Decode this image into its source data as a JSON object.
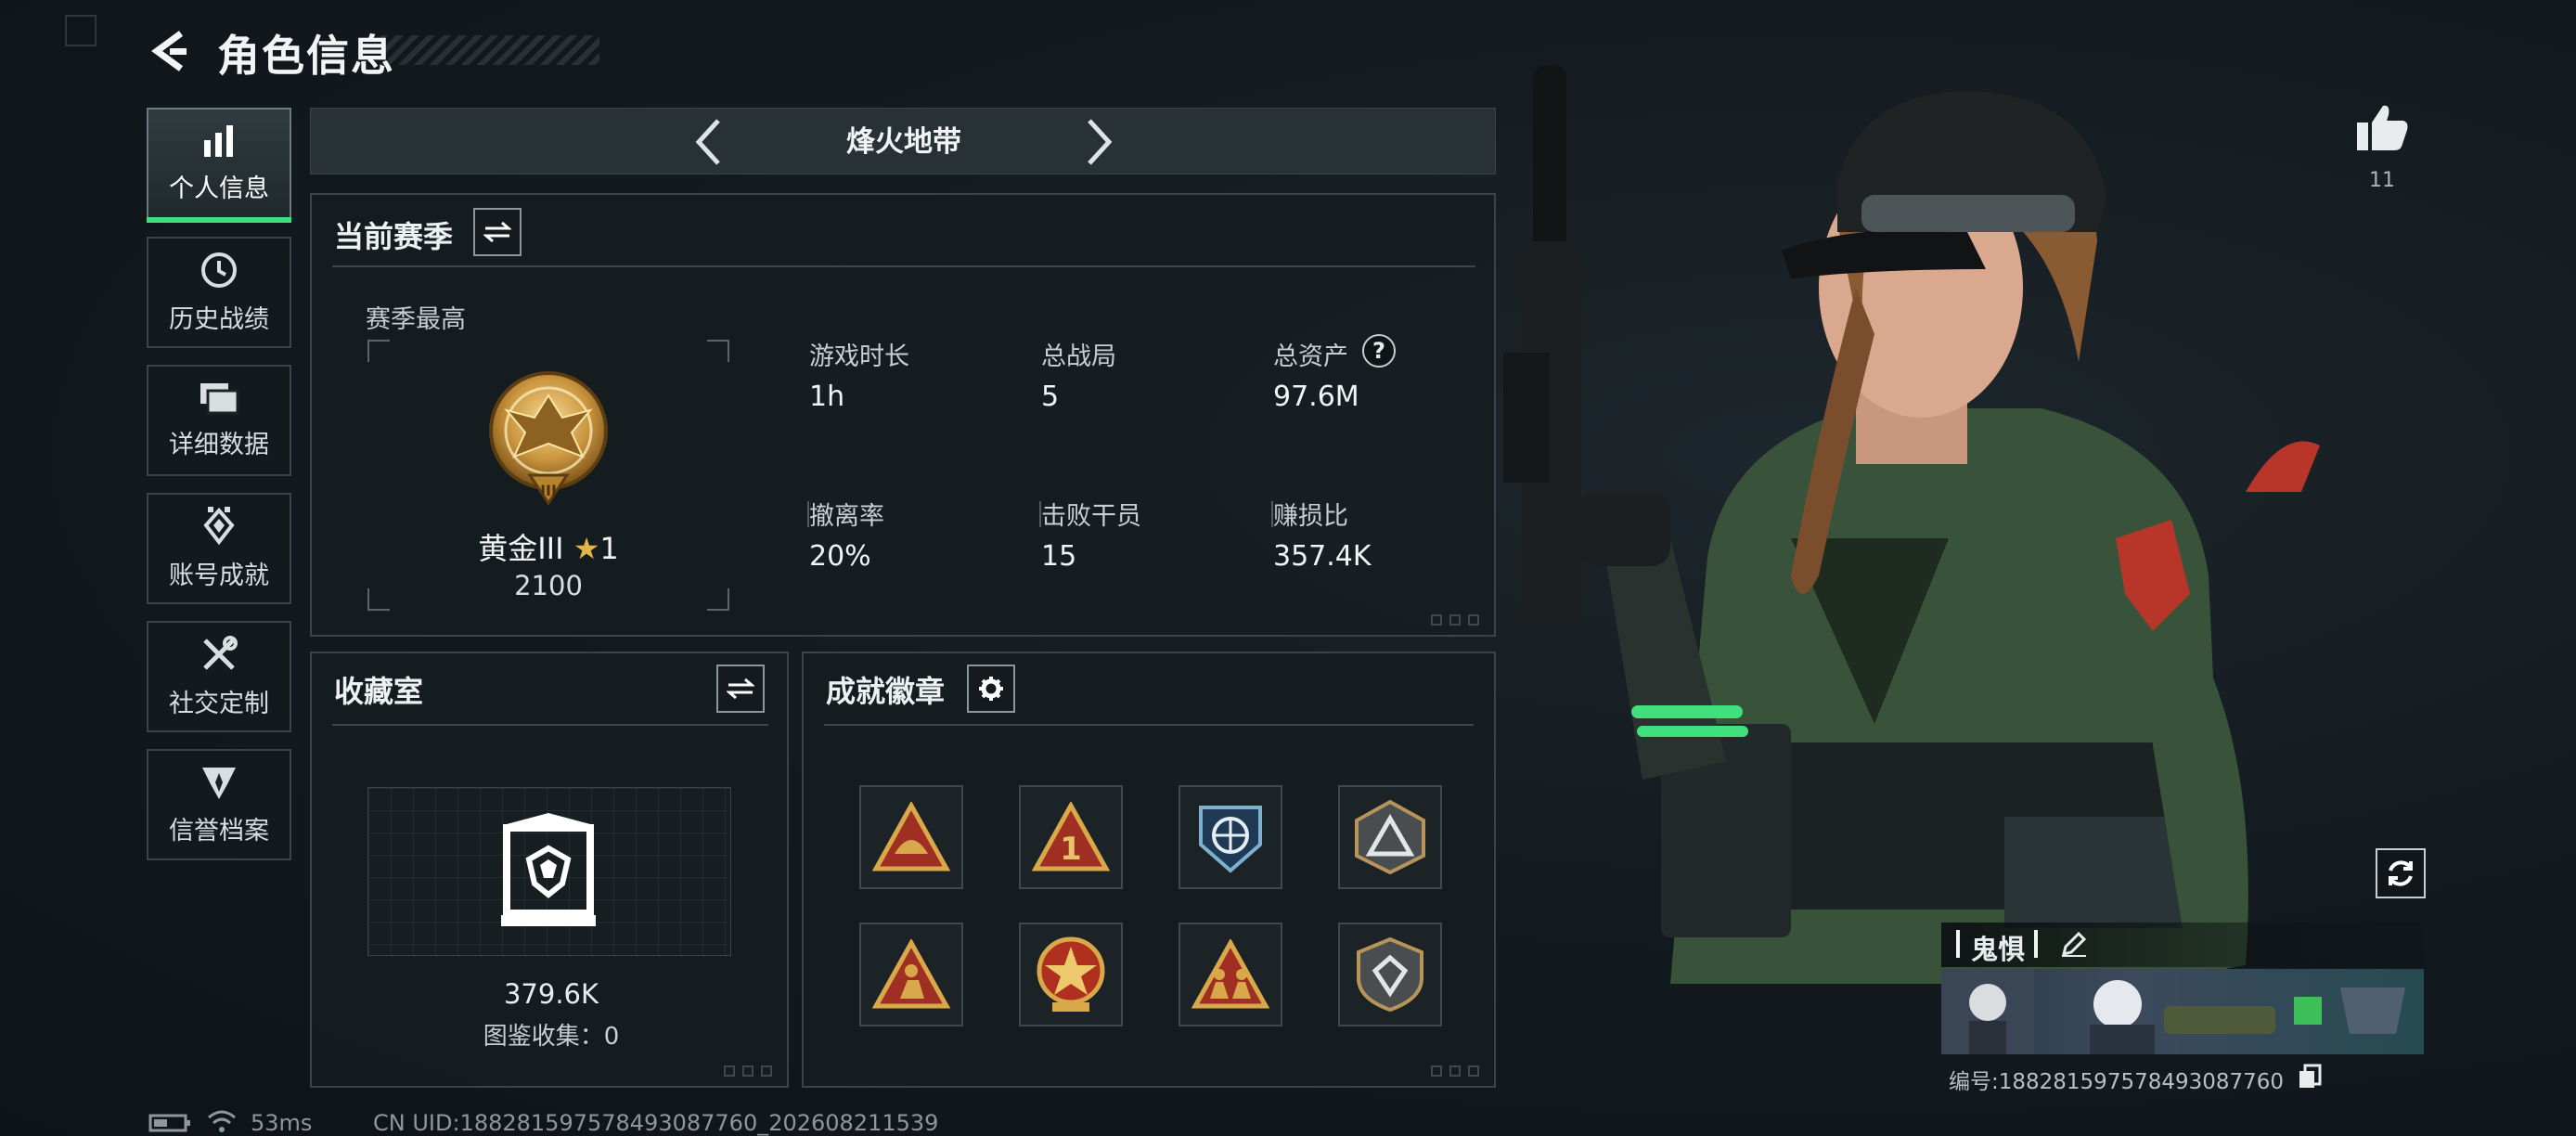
{
  "header": {
    "title": "角色信息"
  },
  "sidebar": {
    "items": [
      {
        "label": "个人信息",
        "icon": "bar-chart-icon",
        "active": true
      },
      {
        "label": "历史战绩",
        "icon": "history-clock-icon",
        "active": false
      },
      {
        "label": "详细数据",
        "icon": "folders-icon",
        "active": false
      },
      {
        "label": "账号成就",
        "icon": "achievement-diamond-icon",
        "active": false
      },
      {
        "label": "社交定制",
        "icon": "wrench-cross-icon",
        "active": false
      },
      {
        "label": "信誉档案",
        "icon": "shield-emblem-icon",
        "active": false
      }
    ]
  },
  "mode": {
    "name": "烽火地带"
  },
  "season": {
    "title": "当前赛季",
    "best_label": "赛季最高",
    "rank_name": "黄金III",
    "rank_stars": "1",
    "rank_score": "2100",
    "stats": [
      {
        "label": "游戏时长",
        "value": "1h"
      },
      {
        "label": "总战局",
        "value": "5"
      },
      {
        "label": "总资产",
        "value": "97.6M",
        "help": "?"
      },
      {
        "label": "撤离率",
        "value": "20%"
      },
      {
        "label": "击败干员",
        "value": "15"
      },
      {
        "label": "赚损比",
        "value": "357.4K"
      }
    ]
  },
  "collection": {
    "title": "收藏室",
    "value": "379.6K",
    "count_label": "图鉴收集：0"
  },
  "achievements": {
    "title": "成就徽章",
    "badges": [
      "helmet-triangle-badge",
      "number-one-triangle-badge",
      "globe-eagle-badge",
      "mountain-triangle-badge",
      "kneeling-soldier-badge",
      "red-star-badge",
      "squad-triangle-badge",
      "shield-diamond-badge"
    ]
  },
  "likes": {
    "count": "11"
  },
  "player_card": {
    "name": "鬼惧",
    "id_text": "编号:18828159757849308776​0"
  },
  "footer": {
    "ping": "53ms",
    "uid": "CN UID:18828159757849308776​0_202608211539"
  },
  "colors": {
    "accent_green": "#3fe07d",
    "panel_border": "#3a4449",
    "gold": "#d9a84b"
  }
}
